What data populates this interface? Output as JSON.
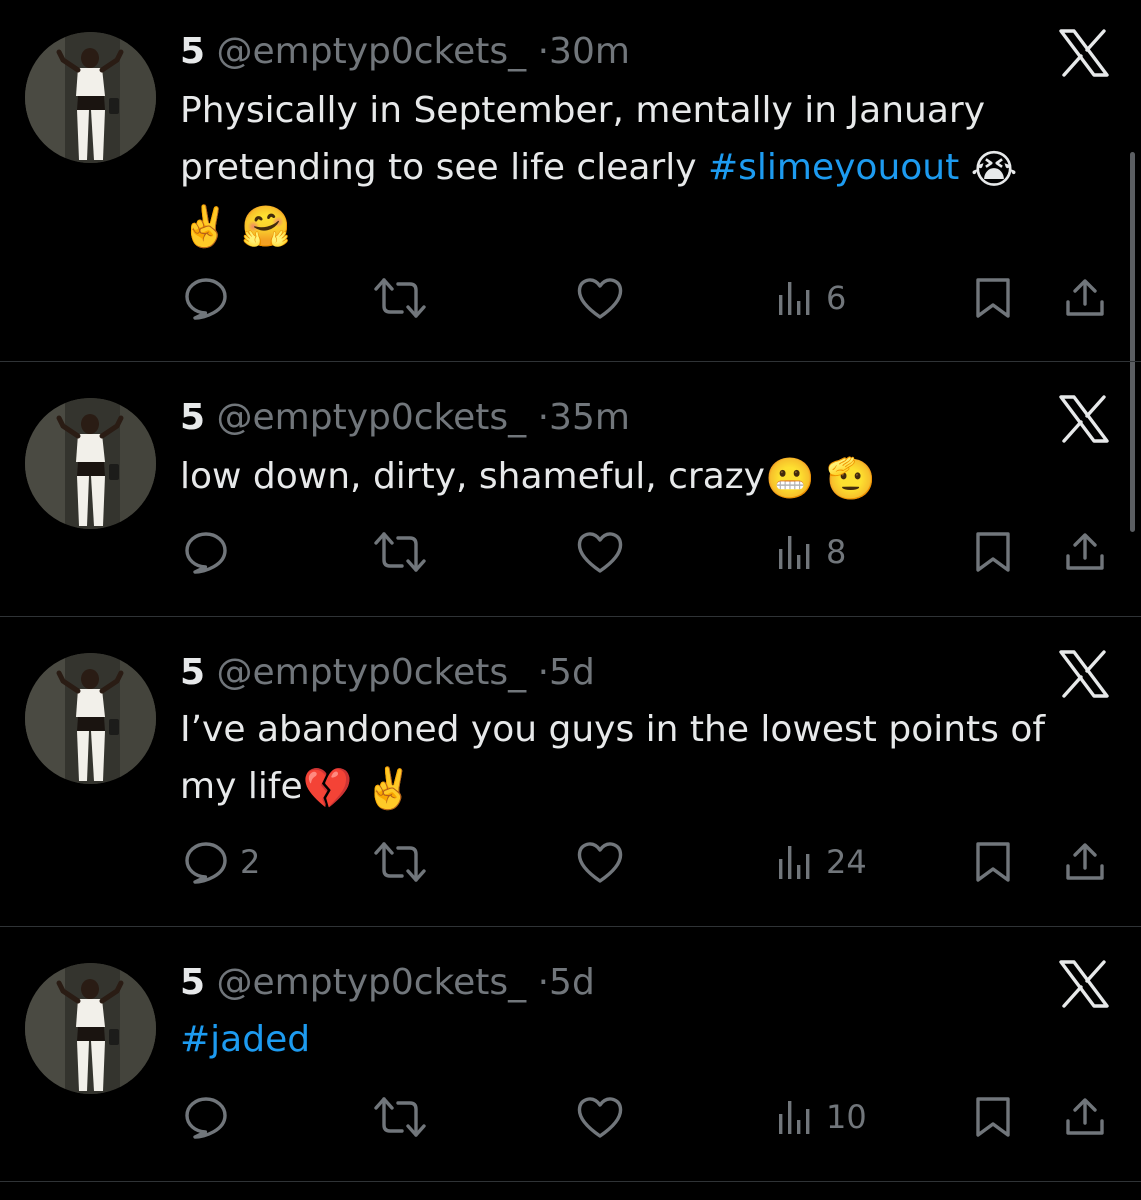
{
  "colors": {
    "background": "#000000",
    "text": "#e7e9ea",
    "muted": "#71767b",
    "hashtag": "#1d9bf0",
    "divider": "#2f3336"
  },
  "tweets": [
    {
      "display_name": "5",
      "handle": "@emptyp0ckets_",
      "separator": "·",
      "time": "30m",
      "text_parts": [
        "Physically in September, mentally in January\npretending to see life clearly ",
        "#slimeyouout",
        " "
      ],
      "emoji_1": "😭",
      "emoji_2": "✌️",
      "emoji_3": "🤗",
      "reply_count": "",
      "views": "6",
      "menu_icon": "x-logo-icon"
    },
    {
      "display_name": "5",
      "handle": "@emptyp0ckets_",
      "separator": "·",
      "time": "35m",
      "text_parts": [
        "low down, dirty, shameful, crazy"
      ],
      "emoji_1": "😬",
      "emoji_2": "🫡",
      "reply_count": "",
      "views": "8",
      "menu_icon": "x-logo-icon"
    },
    {
      "display_name": "5",
      "handle": "@emptyp0ckets_",
      "separator": "·",
      "time": "5d",
      "text_parts": [
        "I’ve abandoned you guys in the lowest points of\nmy life"
      ],
      "emoji_1": "💔",
      "emoji_2": "✌️",
      "reply_count": "2",
      "views": "24",
      "menu_icon": "x-logo-icon"
    },
    {
      "display_name": "5",
      "handle": "@emptyp0ckets_",
      "separator": "·",
      "time": "5d",
      "text_parts": [
        "#jaded"
      ],
      "reply_count": "",
      "views": "10",
      "menu_icon": "x-logo-icon"
    }
  ],
  "action_icons": [
    "reply-icon",
    "retweet-icon",
    "like-icon",
    "views-icon",
    "bookmark-icon",
    "share-icon"
  ]
}
